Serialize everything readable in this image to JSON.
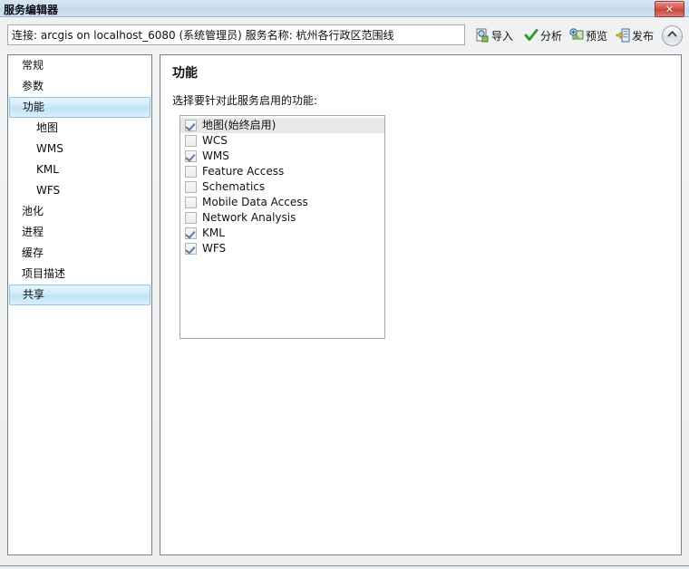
{
  "window": {
    "title": "服务编辑器",
    "close_label": "✕"
  },
  "toolbar": {
    "connection_value": "连接: arcgis on localhost_6080 (系统管理员)   服务名称: 杭州各行政区范围线",
    "connection_placeholder": "连接:",
    "buttons": [
      {
        "label": "导入",
        "icon": "import-icon"
      },
      {
        "label": "分析",
        "icon": "check-icon"
      },
      {
        "label": "预览",
        "icon": "preview-icon"
      },
      {
        "label": "发布",
        "icon": "publish-icon"
      }
    ],
    "collapse_icon": "chevron-up-icon"
  },
  "sidebar": {
    "items": [
      {
        "label": "常规",
        "sub": false,
        "selected": false
      },
      {
        "label": "参数",
        "sub": false,
        "selected": false
      },
      {
        "label": "功能",
        "sub": false,
        "selected": true
      },
      {
        "label": "地图",
        "sub": true,
        "selected": false
      },
      {
        "label": "WMS",
        "sub": true,
        "selected": false
      },
      {
        "label": "KML",
        "sub": true,
        "selected": false
      },
      {
        "label": "WFS",
        "sub": true,
        "selected": false
      },
      {
        "label": "池化",
        "sub": false,
        "selected": false
      },
      {
        "label": "进程",
        "sub": false,
        "selected": false
      },
      {
        "label": "缓存",
        "sub": false,
        "selected": false
      },
      {
        "label": "项目描述",
        "sub": false,
        "selected": false
      },
      {
        "label": "共享",
        "sub": false,
        "selected": true
      }
    ]
  },
  "content": {
    "title": "功能",
    "description": "选择要针对此服务启用的功能:",
    "capabilities": [
      {
        "label": "地图(始终启用)",
        "checked": true,
        "highlight": true
      },
      {
        "label": "WCS",
        "checked": false,
        "highlight": false
      },
      {
        "label": "WMS",
        "checked": true,
        "highlight": false
      },
      {
        "label": "Feature Access",
        "checked": false,
        "highlight": false
      },
      {
        "label": "Schematics",
        "checked": false,
        "highlight": false
      },
      {
        "label": "Mobile Data Access",
        "checked": false,
        "highlight": false
      },
      {
        "label": "Network Analysis",
        "checked": false,
        "highlight": false
      },
      {
        "label": "KML",
        "checked": true,
        "highlight": false
      },
      {
        "label": "WFS",
        "checked": true,
        "highlight": false
      }
    ]
  },
  "colors": {
    "titlebar": "#cfe0f0",
    "selection": "#cfeaf9",
    "close_button": "#d4554c",
    "check_mark": "#5b7ba5",
    "analyze_check": "#2e9b2e"
  }
}
